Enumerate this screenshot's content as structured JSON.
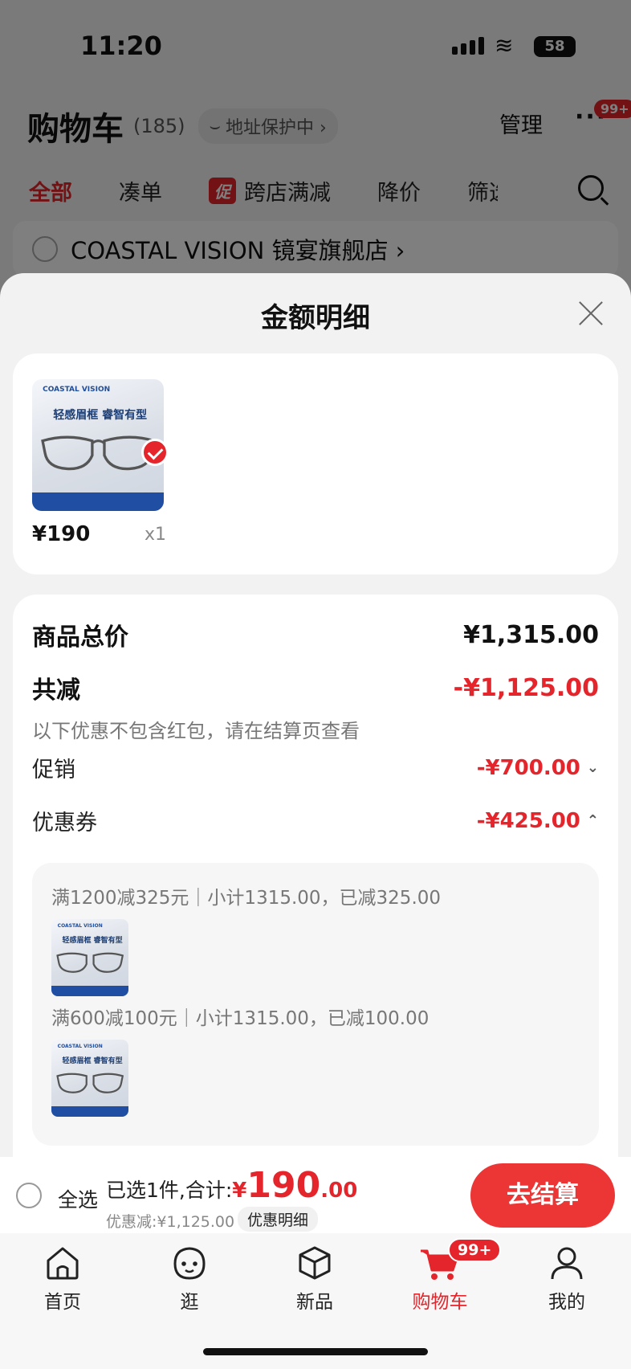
{
  "status": {
    "time": "11:20",
    "battery": "58"
  },
  "cart": {
    "title": "购物车",
    "count": "(185)",
    "address_label": "地址保护中 ›",
    "manage_label": "管理",
    "more_badge": "99+",
    "filter_tabs": [
      "全部",
      "凑单",
      "跨店满减",
      "降价",
      "筛选"
    ],
    "promo_tag": "促",
    "store_name": "COASTAL VISION 镜宴旗舰店 ›"
  },
  "sheet": {
    "title": "金额明细",
    "product": {
      "brand": "COASTAL VISION",
      "slogan": "轻感眉框 睿智有型",
      "price": "¥190",
      "qty": "x1"
    },
    "total_label": "商品总价",
    "total_value": "¥1,315.00",
    "reduce_label": "共减",
    "reduce_value": "-¥1,125.00",
    "reduce_note": "以下优惠不包含红包，请在结算页查看",
    "promo_label": "促销",
    "promo_value": "-¥700.00",
    "coupon_label": "优惠券",
    "coupon_value": "-¥425.00",
    "coupon_lines": [
      "满1200减325元｜小计1315.00，已减325.00",
      "满600减100元｜小计1315.00，已减100.00"
    ]
  },
  "bottom_bar": {
    "select_all": "全选",
    "summary_prefix": "已选1件,合计:",
    "currency": "¥",
    "total_int": "190",
    "total_dec": ".00",
    "discount": "优惠减:¥1,125.00",
    "detail_link": "优惠明细",
    "checkout": "去结算"
  },
  "tab_bar": {
    "items": [
      "首页",
      "逛",
      "新品",
      "购物车",
      "我的"
    ],
    "cart_badge": "99+",
    "active_index": 3
  },
  "colors": {
    "accent": "#e4252b",
    "checkout": "#ec3535"
  }
}
